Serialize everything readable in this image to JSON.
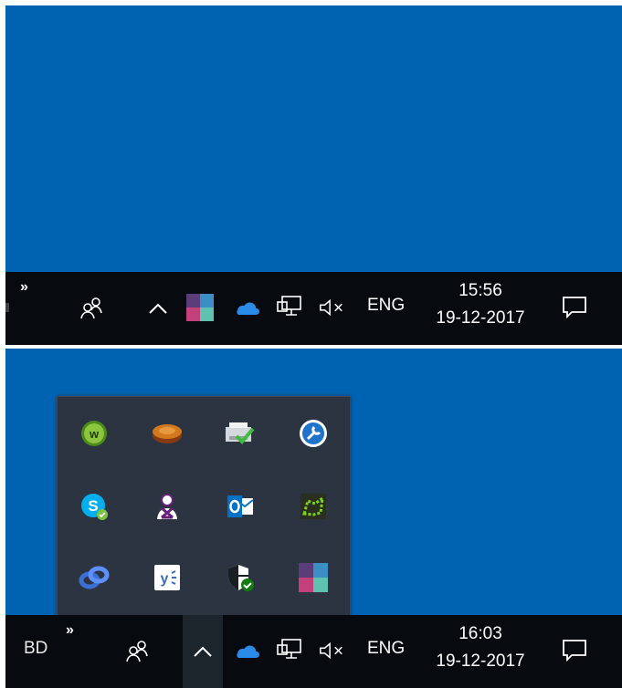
{
  "top_screenshot": {
    "taskbar": {
      "overflow_chevron": "»",
      "language": "ENG",
      "time": "15:56",
      "date": "19-12-2017"
    }
  },
  "bottom_screenshot": {
    "taskbar": {
      "left_label": "BD",
      "overflow_chevron": "»",
      "language": "ENG",
      "time": "16:03",
      "date": "19-12-2017"
    },
    "tray_flyout": {
      "icons": [
        "w-circle-icon",
        "orange-disk-icon",
        "printer-check-icon",
        "blue-tool-icon",
        "skype-icon",
        "vs-profile-icon",
        "outlook-icon",
        "green-map-icon",
        "chain-link-icon",
        "yammer-icon",
        "shield-check-icon",
        "color-squares-icon"
      ]
    }
  },
  "colors": {
    "desktop": "#0063b1",
    "taskbar": "#070b10",
    "flyout": "#2b3440",
    "onedrive": "#2a8ae6"
  }
}
